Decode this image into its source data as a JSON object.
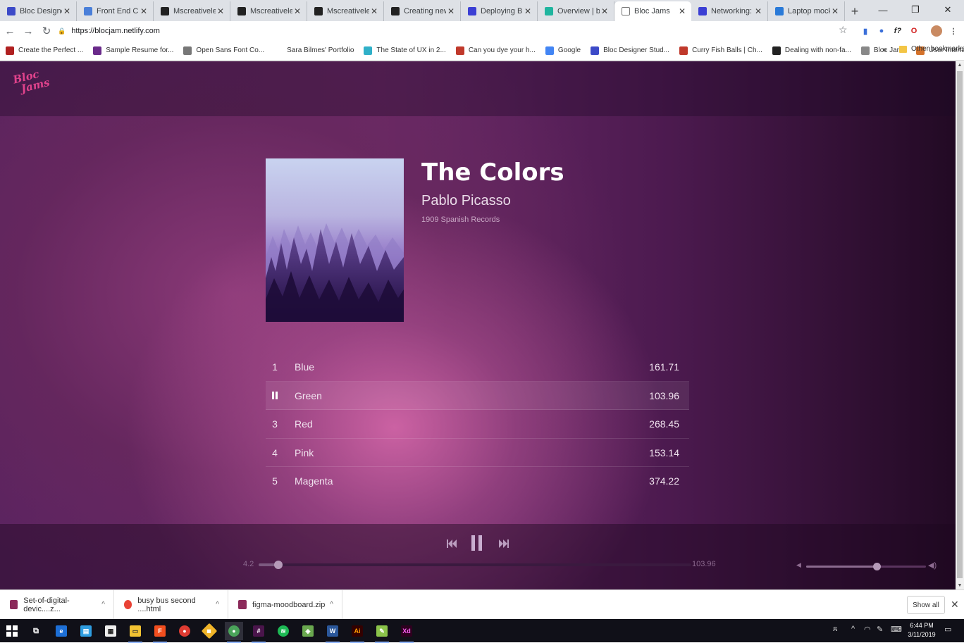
{
  "browser": {
    "tabs": [
      {
        "title": "Bloc Designer St",
        "icon": "bloc-icon",
        "color": "#3c4ac8"
      },
      {
        "title": "Front End Challe",
        "icon": "docs-icon",
        "color": "#4a7fd9"
      },
      {
        "title": "Mscreativelee/cl",
        "icon": "github-icon",
        "color": "#222222"
      },
      {
        "title": "Mscreativelee/bl",
        "icon": "github-icon",
        "color": "#222222"
      },
      {
        "title": "Mscreativelee/bl",
        "icon": "github-icon",
        "color": "#222222"
      },
      {
        "title": "Creating new file",
        "icon": "github-icon",
        "color": "#222222"
      },
      {
        "title": "Deploying Bloc J",
        "icon": "bloc-b-icon",
        "color": "#3b3fd4"
      },
      {
        "title": "Overview | blocja",
        "icon": "netlify-icon",
        "color": "#20b59f"
      },
      {
        "title": "Bloc Jams",
        "icon": "page-icon",
        "color": "#ffffff",
        "active": true
      },
      {
        "title": "Networking: In-p",
        "icon": "bloc-b-icon",
        "color": "#3b3fd4"
      },
      {
        "title": "Laptop mockup",
        "icon": "paw-icon",
        "color": "#2a7ad8"
      }
    ],
    "url": "https://blocjam.netlify.com",
    "bookmarks": [
      {
        "label": "Create the Perfect ...",
        "color": "#b02020"
      },
      {
        "label": "Sample Resume for...",
        "color": "#6a2a8a"
      },
      {
        "label": "Open Sans Font Co...",
        "color": "#777777"
      },
      {
        "label": "Sara Bilmes' Portfolio",
        "color": "#ffffff"
      },
      {
        "label": "The State of UX in 2...",
        "color": "#30b0c8"
      },
      {
        "label": "Can you dye your h...",
        "color": "#c0392b"
      },
      {
        "label": "Google",
        "color": "#4285f4"
      },
      {
        "label": "Bloc Designer Stud...",
        "color": "#3c4ac8"
      },
      {
        "label": "Curry Fish Balls | Ch...",
        "color": "#c0392b"
      },
      {
        "label": "Dealing with non-fa...",
        "color": "#222222"
      },
      {
        "label": "Bloc Jams",
        "color": "#888888"
      },
      {
        "label": "User Interface Elem...",
        "color": "#d4722a"
      }
    ],
    "bookmarks_more": "»",
    "other_bookmarks": "Other bookmarks"
  },
  "app": {
    "logo_line1": "Bloc",
    "logo_line2": "Jams",
    "album": {
      "title": "The Colors",
      "artist": "Pablo Picasso",
      "release": "1909 Spanish Records"
    },
    "songs": [
      {
        "number": "1",
        "title": "Blue",
        "duration": "161.71"
      },
      {
        "number": "2",
        "title": "Green",
        "duration": "103.96",
        "playing": true
      },
      {
        "number": "3",
        "title": "Red",
        "duration": "268.45"
      },
      {
        "number": "4",
        "title": "Pink",
        "duration": "153.14"
      },
      {
        "number": "5",
        "title": "Magenta",
        "duration": "374.22"
      }
    ],
    "player": {
      "current_time": "4.2",
      "total_time": "103.96",
      "progress": 0.045,
      "volume": 0.59
    }
  },
  "downloads": {
    "items": [
      {
        "name": "Set-of-digital-devic....z...",
        "icon": "archive-icon"
      },
      {
        "name": "busy bus second ....html",
        "icon": "chrome-icon"
      },
      {
        "name": "figma-moodboard.zip",
        "icon": "archive-icon"
      }
    ],
    "show_all": "Show all"
  },
  "taskbar": {
    "time": "6:44 PM",
    "date": "3/11/2019"
  }
}
